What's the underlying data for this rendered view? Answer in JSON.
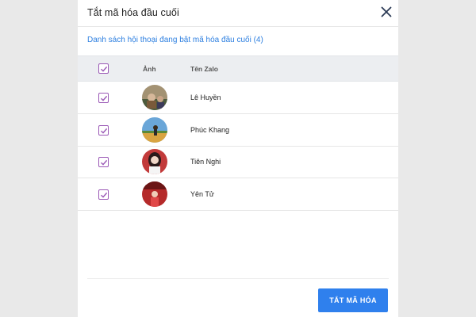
{
  "dialog": {
    "title": "Tắt mã hóa đầu cuối",
    "subtitle": "Danh sách hội thoại đang bật mã hóa đầu cuối (4)",
    "close_icon": "close-icon"
  },
  "table": {
    "headers": {
      "avatar": "Ảnh",
      "name": "Tên Zalo"
    },
    "select_all_checked": true,
    "rows": [
      {
        "name": "Lê Huyền",
        "checked": true,
        "avatar_colors": [
          "#8a7a5a",
          "#4b5a3c"
        ]
      },
      {
        "name": "Phúc Khang",
        "checked": true,
        "avatar_colors": [
          "#6aa6d8",
          "#d9a441"
        ]
      },
      {
        "name": "Tiên Nghi",
        "checked": true,
        "avatar_colors": [
          "#c23a3a",
          "#f0d7c8"
        ]
      },
      {
        "name": "Yên Tử",
        "checked": true,
        "avatar_colors": [
          "#b52a2a",
          "#6b1515"
        ]
      }
    ]
  },
  "actions": {
    "confirm_label": "TẮT MÃ HÓA"
  },
  "colors": {
    "accent": "#2f80ed",
    "checkbox": "#9b59b6",
    "link": "#2d7fe0"
  }
}
